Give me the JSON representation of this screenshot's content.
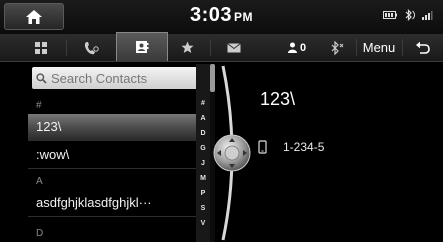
{
  "status": {
    "time": "3:03",
    "ampm": "PM",
    "icons": [
      "battery-icon",
      "bluetooth-signal-icon",
      "network-signal-icon"
    ]
  },
  "toolbar": {
    "tabs": [
      {
        "name": "dial-keypad-icon"
      },
      {
        "name": "recent-calls-icon"
      },
      {
        "name": "contacts-icon",
        "active": true
      },
      {
        "name": "favorites-star-icon"
      },
      {
        "name": "messages-envelope-icon"
      }
    ],
    "contact_count": "0",
    "menu_label": "Menu"
  },
  "search": {
    "placeholder": "Search Contacts"
  },
  "contacts": {
    "groups": [
      {
        "header": "#",
        "entries": [
          "123\\"
        ]
      },
      {
        "header": "",
        "entries": [
          ":wow\\"
        ]
      },
      {
        "header": "A",
        "entries": [
          "asdfghjklasdfghjkl···"
        ]
      },
      {
        "header": "D",
        "entries": []
      }
    ],
    "selected": "123\\"
  },
  "alpha_index": [
    "#",
    "A",
    "D",
    "G",
    "J",
    "M",
    "P",
    "S",
    "V"
  ],
  "detail": {
    "name": "123\\",
    "phone_number": "1-234-5"
  },
  "colors": {
    "background": "#000000",
    "accent": "#ffffff",
    "selected_row": "#5a5a5a"
  }
}
